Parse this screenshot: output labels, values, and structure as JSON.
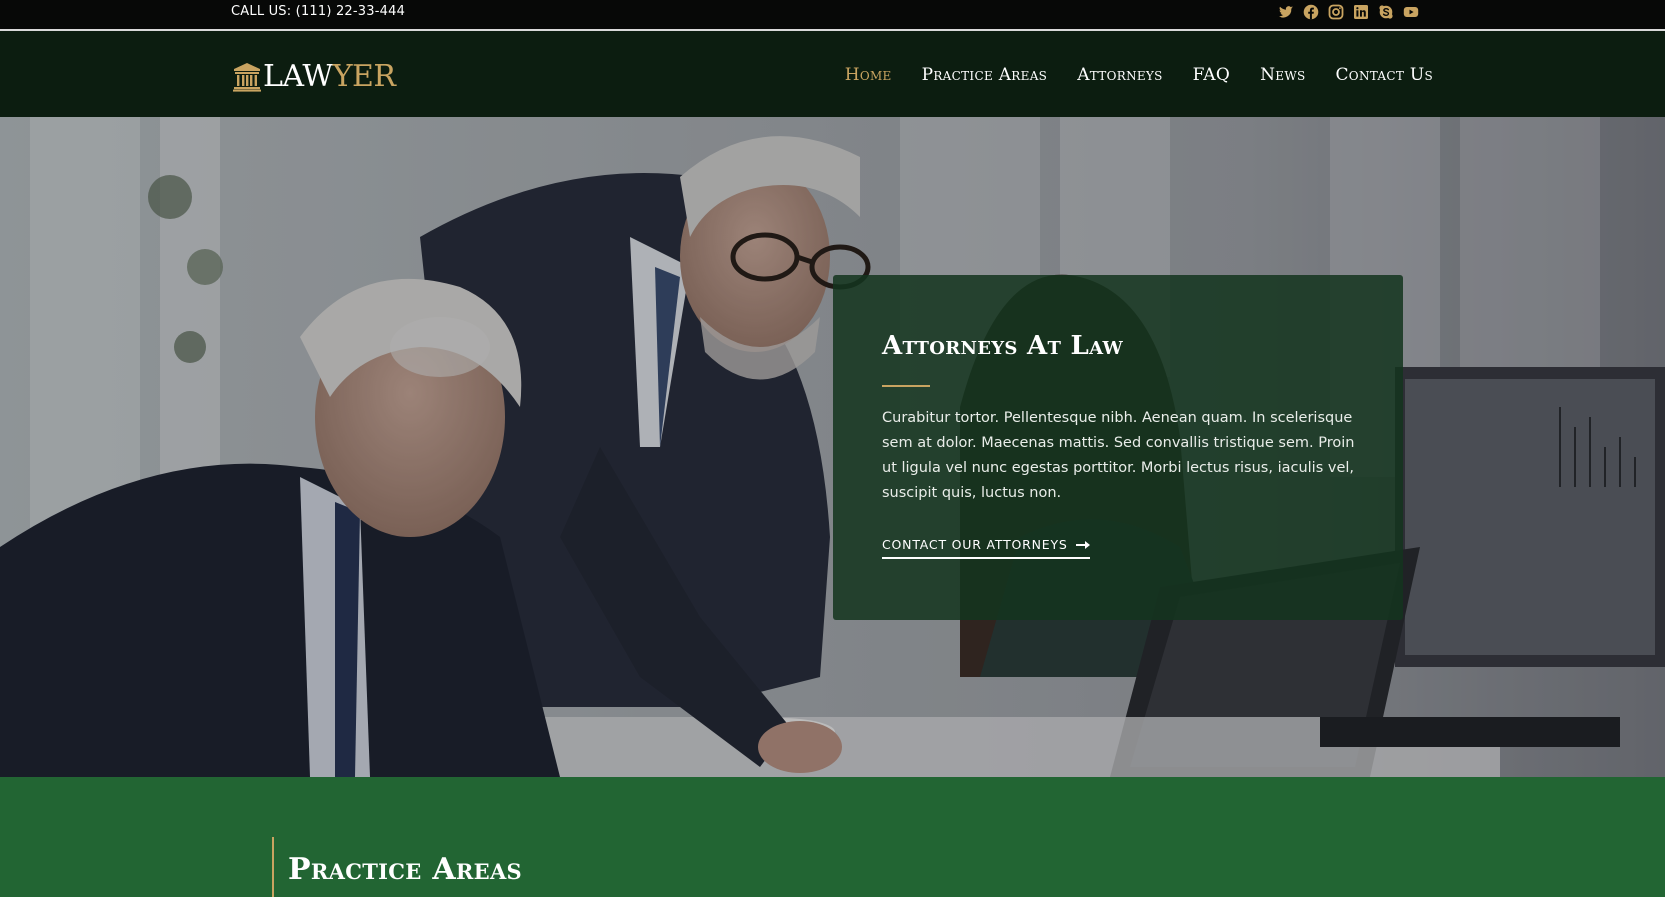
{
  "topbar": {
    "phone": "CALL US: (111) 22-33-444",
    "social_icons": [
      "twitter-icon",
      "facebook-icon",
      "instagram-icon",
      "linkedin-icon",
      "skype-icon",
      "youtube-icon"
    ],
    "icon_color": "#c9a461"
  },
  "header": {
    "logo": {
      "part1": "LAW",
      "part2": "YER"
    },
    "nav": [
      "Home",
      "Practice Areas",
      "Attorneys",
      "FAQ",
      "News",
      "Contact Us"
    ],
    "active_item": "Home"
  },
  "hero": {
    "title": "Attorneys At Law",
    "text": "Curabitur tortor. Pellentesque nibh. Aenean quam. In scelerisque sem at dolor. Maecenas mattis. Sed convallis tristique sem. Proin ut ligula vel nunc egestas porttitor. Morbi lectus risus, iaculis vel, suscipit quis, luctus non.",
    "cta": "CONTACT OUR ATTORNEYS"
  },
  "practice": {
    "title": "Practice Areas"
  },
  "colors": {
    "accent": "#c9a461",
    "header_bg": "#0c1d10",
    "topbar_bg": "#070807",
    "section_green": "#226533"
  }
}
